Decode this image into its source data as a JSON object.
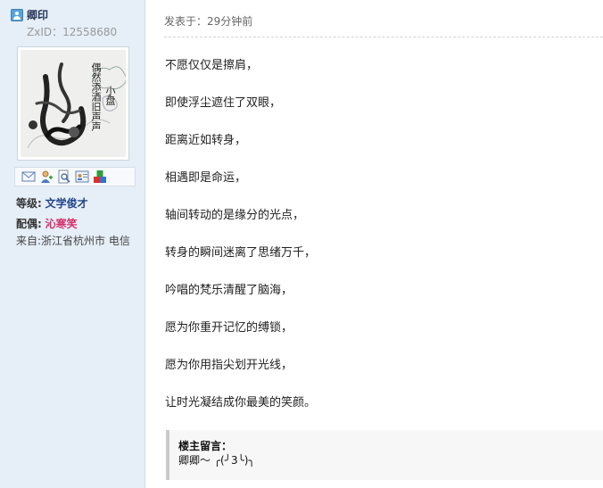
{
  "user": {
    "name": "卿印",
    "zxid": "ZxID：12558680",
    "avatar_caption_line1": "偶然添酒旧声声",
    "avatar_caption_line2": "小盘"
  },
  "actions": [
    {
      "name": "send-message",
      "icon": "envelope-icon"
    },
    {
      "name": "add-friend",
      "icon": "add-user-icon"
    },
    {
      "name": "view-profile",
      "icon": "search-document-icon"
    },
    {
      "name": "user-card",
      "icon": "profile-card-icon"
    },
    {
      "name": "send-gift",
      "icon": "gift-blocks-icon"
    }
  ],
  "profile": {
    "rank_label": "等级:",
    "rank_value": "文学俊才",
    "spouse_label": "配偶:",
    "spouse_value": "沁寒笑",
    "from_text": "来自:浙江省杭州市 电信"
  },
  "post": {
    "meta": "发表于：29分钟前",
    "lines": [
      "不愿仅仅是擦肩，",
      "即使浮尘遮住了双眼，",
      "距离近如转身，",
      "相遇即是命运，",
      "轴间转动的是缘分的光点，",
      "转身的瞬间迷离了思绪万千，",
      "吟唱的梵乐清醒了脑海，",
      "愿为你重开记忆的缚锁，",
      "愿为你用指尖划开光线，",
      "让时光凝结成你最美的笑颜。"
    ]
  },
  "owner_note": {
    "title": "楼主留言：",
    "text": "卿卿～ ╭(╯3╰)╮"
  },
  "colors": {
    "sidebar_bg": "#e6eef7",
    "rank": "#22448a",
    "spouse": "#d4306a"
  }
}
